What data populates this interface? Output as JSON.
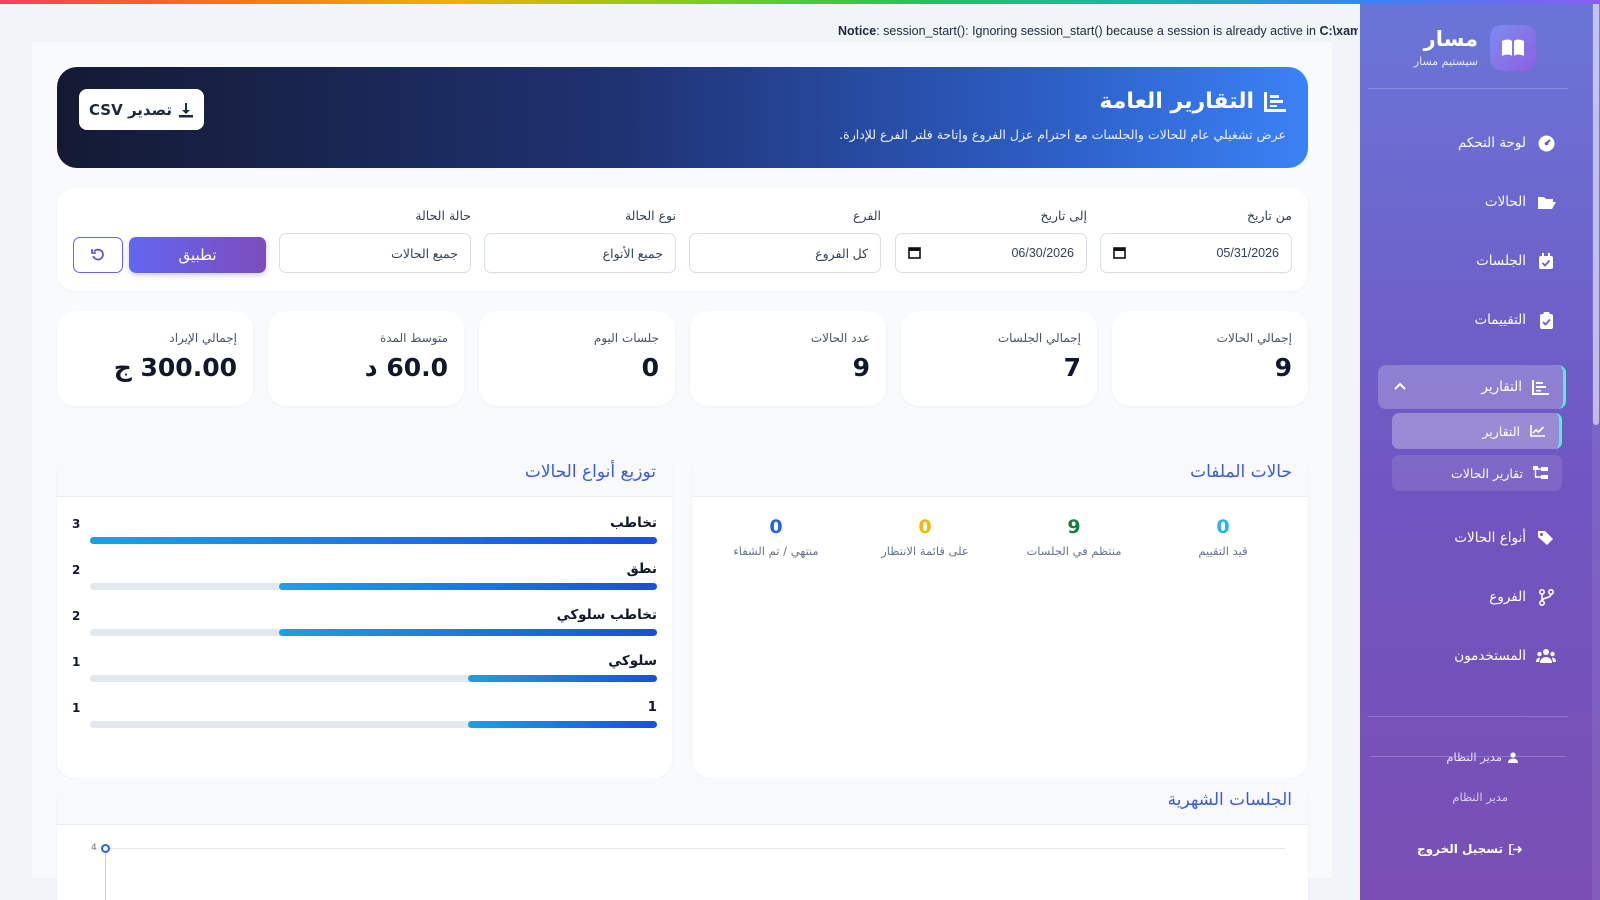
{
  "notice": {
    "label": "Notice",
    "message": ": session_start(): Ignoring session_start() because a session is already active in ",
    "path": "C:\\xam"
  },
  "sidebar": {
    "brand": {
      "name": "مسار",
      "subtitle": "سيستيم مسار"
    },
    "items": [
      {
        "label": "لوحة التحكم",
        "icon": "dashboard-icon"
      },
      {
        "label": "الحالات",
        "icon": "folder-open-icon"
      },
      {
        "label": "الجلسات",
        "icon": "calendar-check-icon"
      },
      {
        "label": "التقييمات",
        "icon": "clipboard-check-icon"
      }
    ],
    "active_group": {
      "label": "التقارير",
      "icon": "report-icon"
    },
    "sub_items": [
      {
        "label": "التقارير",
        "icon": "chart-line-icon",
        "active": true
      },
      {
        "label": "تقارير الحالات",
        "icon": "folder-tree-icon",
        "active": false
      }
    ],
    "items_after": [
      {
        "label": "أنواع الحالات",
        "icon": "tags-icon"
      },
      {
        "label": "الفروع",
        "icon": "code-branch-icon"
      },
      {
        "label": "المستخدمون",
        "icon": "users-icon"
      }
    ],
    "user": {
      "role": "مدير النظام",
      "name": "مدير النظام"
    },
    "logout_label": "تسجيل الخروج"
  },
  "header": {
    "title": "التقارير العامة",
    "subtitle": "عرض تشغيلي عام للحالات والجلسات مع احترام عزل الفروع وإتاحة فلتر الفرع للإدارة.",
    "export_label": "تصدير CSV"
  },
  "filters": {
    "from_date": {
      "label": "من تاريخ",
      "value": "05/31/2026"
    },
    "to_date": {
      "label": "إلى تاريخ",
      "value": "06/30/2026"
    },
    "branch": {
      "label": "الفرع",
      "value": "كل الفروع"
    },
    "case_type": {
      "label": "نوع الحالة",
      "value": "جميع الأنواع"
    },
    "case_status": {
      "label": "حالة الحالة",
      "value": "جميع الحالات"
    },
    "apply_label": "تطبيق"
  },
  "stats": [
    {
      "label": "إجمالي الحالات",
      "value": "9"
    },
    {
      "label": "إجمالي الجلسات",
      "value": "7"
    },
    {
      "label": "عدد الحالات",
      "value": "9"
    },
    {
      "label": "جلسات اليوم",
      "value": "0"
    },
    {
      "label": "متوسط المدة",
      "value": "60.0 د"
    },
    {
      "label": "إجمالي الإيراد",
      "value": "300.00 ج"
    }
  ],
  "file_statuses": {
    "title": "حالات الملفات",
    "items": [
      {
        "label": "قيد التقييم",
        "value": "0",
        "color": "#22b8e6"
      },
      {
        "label": "منتظم في الجلسات",
        "value": "9",
        "color": "#15803d"
      },
      {
        "label": "على قائمة الانتظار",
        "value": "0",
        "color": "#f5b50a"
      },
      {
        "label": "منتهي / تم الشفاء",
        "value": "0",
        "color": "#2563eb"
      }
    ]
  },
  "type_distribution": {
    "title": "توزيع أنواع الحالات",
    "max": 3,
    "items": [
      {
        "label": "تخاطب",
        "count": "3",
        "value": 3
      },
      {
        "label": "نطق",
        "count": "2",
        "value": 2
      },
      {
        "label": "تخاطب سلوكي",
        "count": "2",
        "value": 2
      },
      {
        "label": "سلوكي",
        "count": "1",
        "value": 1
      },
      {
        "label": "1",
        "count": "1",
        "value": 1
      }
    ]
  },
  "monthly_sessions": {
    "title": "الجلسات الشهرية",
    "y_tick": "4"
  }
}
